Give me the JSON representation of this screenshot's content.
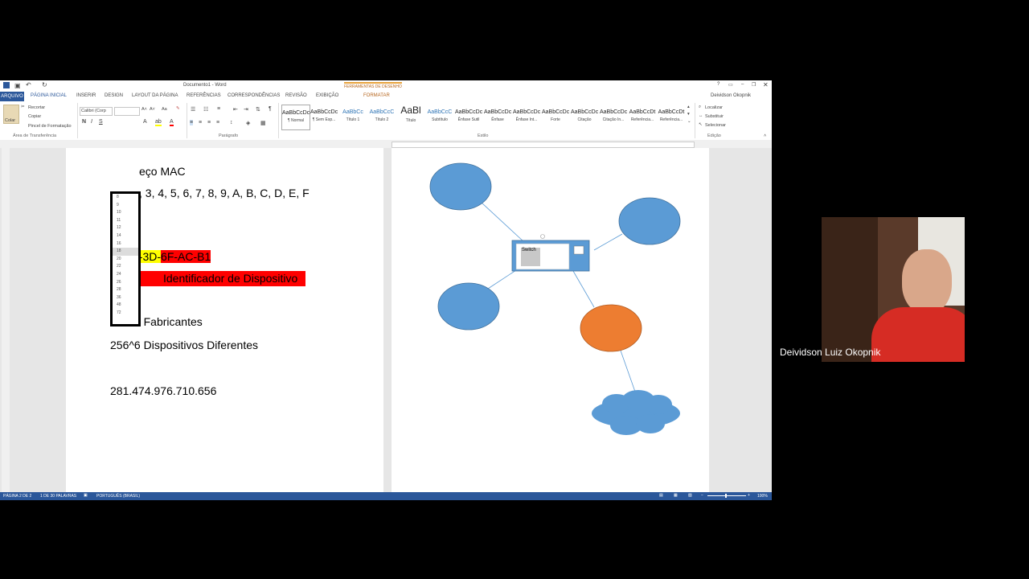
{
  "window": {
    "title": "Documento1 - Word",
    "user": "Deividson Okopnik"
  },
  "ribbon_context": {
    "group_label": "FERRAMENTAS DE DESENHO",
    "tab_label": "FORMATAR"
  },
  "tabs": [
    "ARQUIVO",
    "PÁGINA INICIAL",
    "INSERIR",
    "DESIGN",
    "LAYOUT DA PÁGINA",
    "REFERÊNCIAS",
    "CORRESPONDÊNCIAS",
    "REVISÃO",
    "EXIBIÇÃO"
  ],
  "clipboard": {
    "cut": "Recortar",
    "copy": "Copiar",
    "painter": "Pincel de Formatação",
    "paste": "Colar",
    "group": "Área de Transferência"
  },
  "font": {
    "name": "Calibri (Corp"
  },
  "font_sizes": [
    "8",
    "9",
    "10",
    "11",
    "12",
    "14",
    "16",
    "18",
    "20",
    "22",
    "24",
    "26",
    "28",
    "36",
    "48",
    "72"
  ],
  "paragraph_group": "Parágrafo",
  "styles": [
    {
      "preview": "AaBbCcDc",
      "name": "¶ Normal"
    },
    {
      "preview": "AaBbCcDc",
      "name": "¶ Sem Esp..."
    },
    {
      "preview": "AaBbCc",
      "name": "Título 1"
    },
    {
      "preview": "AaBbCcC",
      "name": "Título 2"
    },
    {
      "preview": "AaBl",
      "name": "Título"
    },
    {
      "preview": "AaBbCcC",
      "name": "Subtítulo"
    },
    {
      "preview": "AaBbCcDc",
      "name": "Ênfase Sutil"
    },
    {
      "preview": "AaBbCcDc",
      "name": "Ênfase"
    },
    {
      "preview": "AaBbCcDc",
      "name": "Ênfase Int..."
    },
    {
      "preview": "AaBbCcDc",
      "name": "Forte"
    },
    {
      "preview": "AaBbCcDc",
      "name": "Citação"
    },
    {
      "preview": "AaBbCcDc",
      "name": "Citação In..."
    },
    {
      "preview": "AaBbCcDt",
      "name": "Referência..."
    },
    {
      "preview": "AaBbCcDt",
      "name": "Referência..."
    }
  ],
  "styles_group": "Estilo",
  "editing": {
    "find": "Localizar",
    "replace": "Substituir",
    "select": "Selecionar",
    "group": "Edição"
  },
  "doc": {
    "line1": "eço MAC",
    "line2": ", 3, 4, 5, 6, 7, 8, 9, A, B, C, D, E, F",
    "mac_yellow": "01-25-3D-",
    "mac_red": "6F-AC-B1",
    "id_label": "Identificador de Dispositivo",
    "fab": "256^6 Fabricantes",
    "devs": "256^6 Dispositivos Diferentes",
    "big": "281.474.976.710.656"
  },
  "diagram": {
    "switch_label": "Switch"
  },
  "status": {
    "page": "PÁGINA 2 DE 2",
    "words": "1 DE 30 PALAVRAS",
    "lang": "PORTUGUÊS (BRASIL)",
    "zoom": "100%"
  },
  "webcam": {
    "name": "Deividson Luiz Okopnik"
  },
  "colors": {
    "accent": "#2b579a",
    "shape_blue": "#5b9bd5",
    "shape_orange": "#ed7d31",
    "highlight_yellow": "#ffff00",
    "highlight_red": "#ff0000"
  }
}
